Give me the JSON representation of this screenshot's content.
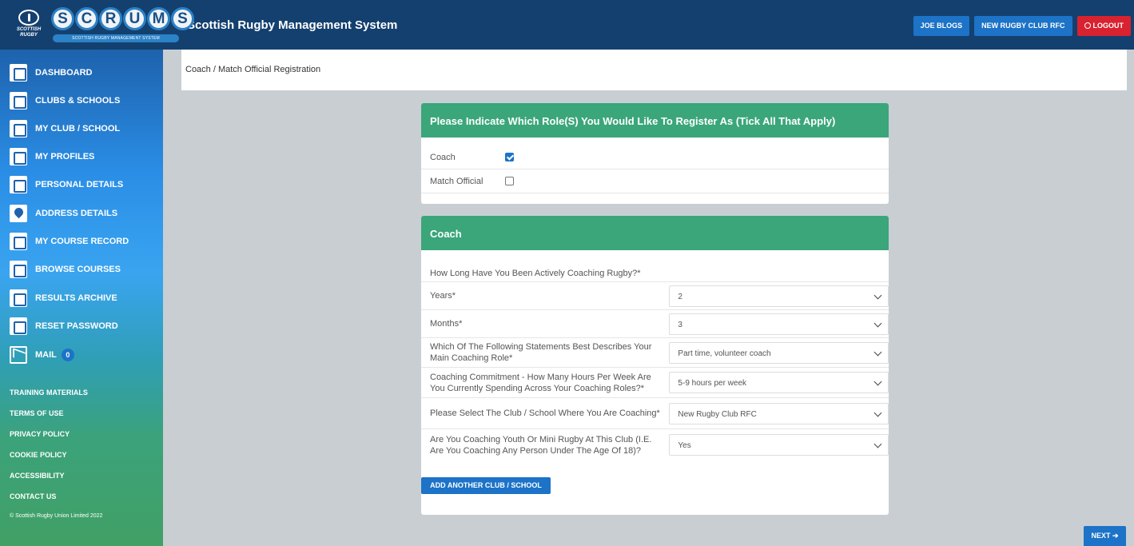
{
  "header": {
    "logo_letters": [
      "S",
      "C",
      "R",
      "U",
      "M",
      "S"
    ],
    "logo_sub": "SCOTTISH RUGBY MANAGEMENT SYSTEM",
    "crest_text": "SCOTTISH RUGBY",
    "app_title": "Scottish Rugby Management System",
    "user_label": "JOE BLOGS",
    "club_label": "NEW RUGBY CLUB RFC",
    "logout_label": "LOGOUT"
  },
  "sidebar": {
    "items": [
      {
        "label": "DASHBOARD",
        "icon": "dashboard-icon"
      },
      {
        "label": "CLUBS & SCHOOLS",
        "icon": "goalposts-icon"
      },
      {
        "label": "MY CLUB / SCHOOL",
        "icon": "club-icon"
      },
      {
        "label": "MY PROFILES",
        "icon": "profiles-icon"
      },
      {
        "label": "PERSONAL DETAILS",
        "icon": "person-icon"
      },
      {
        "label": "ADDRESS DETAILS",
        "icon": "map-pin-icon"
      },
      {
        "label": "MY COURSE RECORD",
        "icon": "course-record-icon"
      },
      {
        "label": "BROWSE COURSES",
        "icon": "browse-icon"
      },
      {
        "label": "RESULTS ARCHIVE",
        "icon": "archive-icon"
      },
      {
        "label": "RESET PASSWORD",
        "icon": "lock-icon"
      },
      {
        "label": "MAIL",
        "icon": "mail-icon"
      }
    ],
    "mail_count": "0",
    "footer_links": [
      "TRAINING MATERIALS",
      "TERMS OF USE",
      "PRIVACY POLICY",
      "COOKIE POLICY",
      "ACCESSIBILITY",
      "CONTACT US"
    ],
    "copyright": "© Scottish Rugby Union Limited 2022"
  },
  "breadcrumb": "Coach / Match Official Registration",
  "roles_card": {
    "title": "Please Indicate Which Role(S) You Would Like To Register As (Tick All That Apply)",
    "options": [
      {
        "label": "Coach",
        "checked": true
      },
      {
        "label": "Match Official",
        "checked": false
      }
    ]
  },
  "coach_card": {
    "title": "Coach",
    "intro": "How Long Have You Been Actively Coaching Rugby?*",
    "fields": [
      {
        "label": "Years*",
        "value": "2"
      },
      {
        "label": "Months*",
        "value": "3"
      },
      {
        "label": "Which Of The Following Statements Best Describes Your Main Coaching Role*",
        "value": "Part time, volunteer coach"
      },
      {
        "label": "Coaching Commitment - How Many Hours Per Week Are You Currently Spending Across Your Coaching Roles?*",
        "value": "5-9 hours per week"
      },
      {
        "label": "Please Select The Club / School Where You Are Coaching*",
        "value": "New Rugby Club RFC"
      },
      {
        "label": "Are You Coaching Youth Or Mini Rugby At This Club (I.E. Are You Coaching Any Person Under The Age Of 18)?",
        "value": "Yes"
      }
    ],
    "add_button": "ADD ANOTHER CLUB / SCHOOL"
  },
  "next_button": "NEXT",
  "colors": {
    "header": "#14406f",
    "accent": "#1c73c7",
    "card_head": "#3aa67a",
    "logout": "#d9222f"
  }
}
